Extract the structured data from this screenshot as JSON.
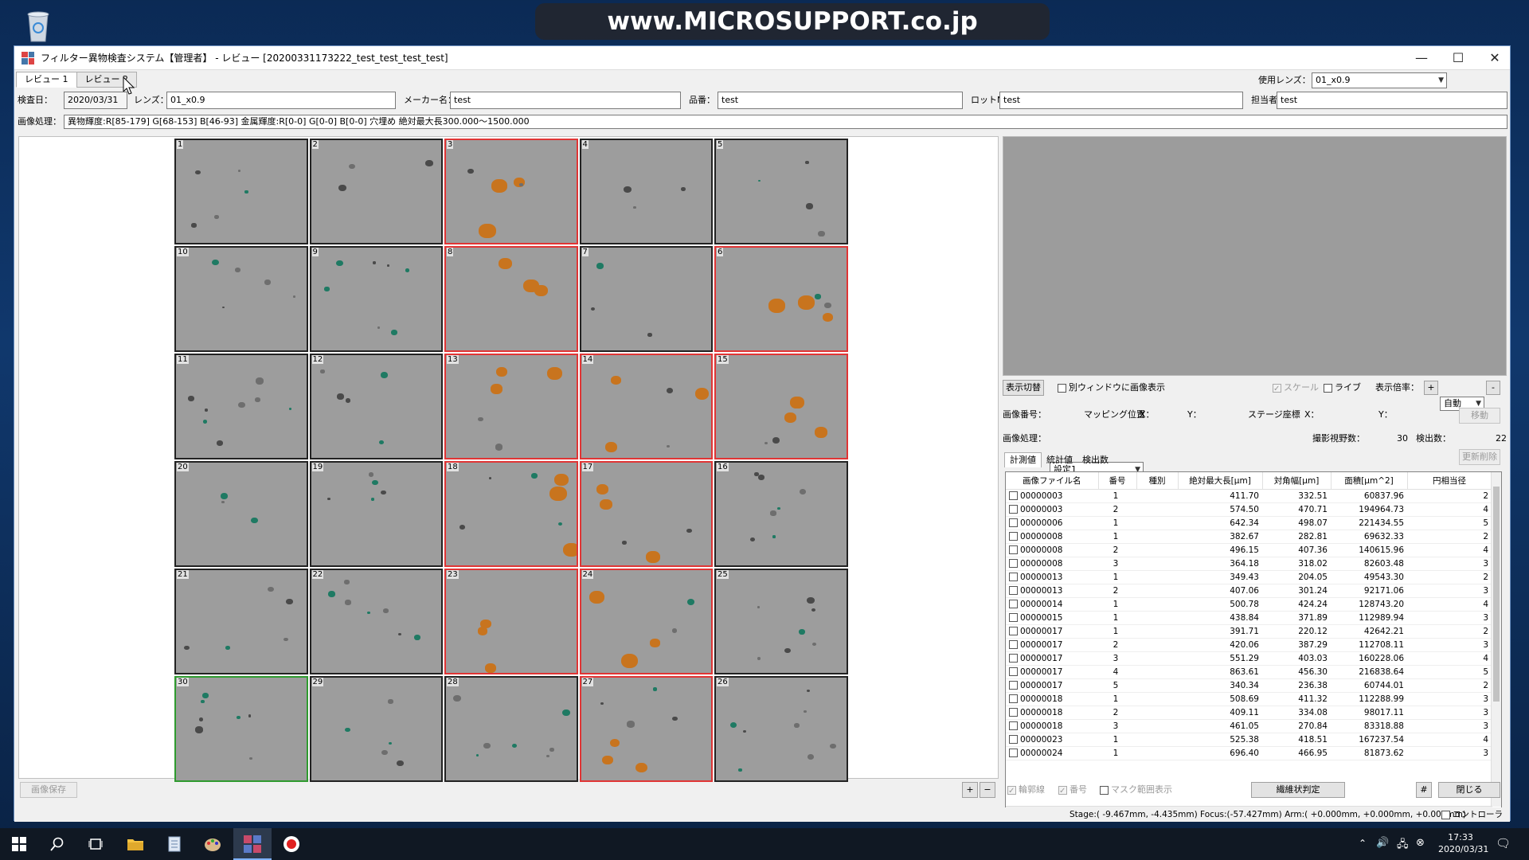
{
  "desktop": {
    "banner": "www.MICROSUPPORT.co.jp",
    "recycle_icon": "recycle-bin-icon"
  },
  "window": {
    "title": "フィルター異物検査システム【管理者】 - レビュー [20200331173222_test_test_test_test]",
    "controls": {
      "minimize": "—",
      "maximize": "☐",
      "close": "✕"
    }
  },
  "tabs": [
    "レビュー 1",
    "レビュー 2"
  ],
  "lens_select": {
    "label": "使用レンズ：",
    "value": "01_x0.9"
  },
  "info": {
    "date_label": "検査日：",
    "date": "2020/03/31",
    "lens_label": "レンズ：",
    "lens": "01_x0.9",
    "maker_label": "メーカー名：",
    "maker": "test",
    "part_label": "品番：",
    "part": "test",
    "lot_label": "ロットNo.：",
    "lot": "test",
    "person_label": "担当者：",
    "person": "test"
  },
  "processing": {
    "label": "画像処理：",
    "text": "異物輝度:R[85-179] G[68-153] B[46-93]  金属輝度:R[0-0] G[0-0] B[0-0]  穴埋め  絶対最大長300.000～1500.000"
  },
  "grid": {
    "rows": [
      [
        {
          "n": "1",
          "s": ""
        },
        {
          "n": "2",
          "s": ""
        },
        {
          "n": "3",
          "s": "red"
        },
        {
          "n": "4",
          "s": ""
        },
        {
          "n": "5",
          "s": ""
        }
      ],
      [
        {
          "n": "10",
          "s": ""
        },
        {
          "n": "9",
          "s": ""
        },
        {
          "n": "8",
          "s": "red"
        },
        {
          "n": "7",
          "s": ""
        },
        {
          "n": "6",
          "s": "red"
        }
      ],
      [
        {
          "n": "11",
          "s": ""
        },
        {
          "n": "12",
          "s": ""
        },
        {
          "n": "13",
          "s": "red"
        },
        {
          "n": "14",
          "s": "red"
        },
        {
          "n": "15",
          "s": "red"
        }
      ],
      [
        {
          "n": "20",
          "s": ""
        },
        {
          "n": "19",
          "s": ""
        },
        {
          "n": "18",
          "s": "red"
        },
        {
          "n": "17",
          "s": "red"
        },
        {
          "n": "16",
          "s": ""
        }
      ],
      [
        {
          "n": "21",
          "s": ""
        },
        {
          "n": "22",
          "s": ""
        },
        {
          "n": "23",
          "s": "red"
        },
        {
          "n": "24",
          "s": "red"
        },
        {
          "n": "25",
          "s": ""
        }
      ],
      [
        {
          "n": "30",
          "s": "green"
        },
        {
          "n": "29",
          "s": ""
        },
        {
          "n": "28",
          "s": ""
        },
        {
          "n": "27",
          "s": "red"
        },
        {
          "n": "26",
          "s": ""
        }
      ]
    ]
  },
  "grid_buttons": {
    "save": "画像保存",
    "plus": "+",
    "minus": "−"
  },
  "right": {
    "toggle_display": "表示切替",
    "separate_window": "別ウィンドウに画像表示",
    "scale": "スケール",
    "live": "ライブ",
    "zoom_label": "表示倍率：",
    "zoom_plus": "+",
    "zoom_value": "自動",
    "zoom_minus": "-",
    "image_no_label": "画像番号：",
    "mapping_label": "マッピング位置",
    "x_label": "X：",
    "y_label": "Y：",
    "stage_label": "ステージ座標",
    "move": "移動",
    "proc_label": "画像処理：",
    "proc_value": "設定1",
    "fields_label": "撮影視野数：",
    "fields_value": "30",
    "detect_label": "検出数：",
    "detect_value": "22",
    "refresh": "更新削除",
    "subtabs": [
      "計測値",
      "統計値",
      "検出数"
    ]
  },
  "table": {
    "headers": [
      "画像ファイル名",
      "番号",
      "種別",
      "絶対最大長[μm]",
      "対角幅[μm]",
      "面積[μm^2]",
      "円相当径"
    ],
    "rows": [
      [
        "00000003",
        "1",
        "",
        "411.70",
        "332.51",
        "60837.96",
        "2"
      ],
      [
        "00000003",
        "2",
        "",
        "574.50",
        "470.71",
        "194964.73",
        "4"
      ],
      [
        "00000006",
        "1",
        "",
        "642.34",
        "498.07",
        "221434.55",
        "5"
      ],
      [
        "00000008",
        "1",
        "",
        "382.67",
        "282.81",
        "69632.33",
        "2"
      ],
      [
        "00000008",
        "2",
        "",
        "496.15",
        "407.36",
        "140615.96",
        "4"
      ],
      [
        "00000008",
        "3",
        "",
        "364.18",
        "318.02",
        "82603.48",
        "3"
      ],
      [
        "00000013",
        "1",
        "",
        "349.43",
        "204.05",
        "49543.30",
        "2"
      ],
      [
        "00000013",
        "2",
        "",
        "407.06",
        "301.24",
        "92171.06",
        "3"
      ],
      [
        "00000014",
        "1",
        "",
        "500.78",
        "424.24",
        "128743.20",
        "4"
      ],
      [
        "00000015",
        "1",
        "",
        "438.84",
        "371.89",
        "112989.94",
        "3"
      ],
      [
        "00000017",
        "1",
        "",
        "391.71",
        "220.12",
        "42642.21",
        "2"
      ],
      [
        "00000017",
        "2",
        "",
        "420.06",
        "387.29",
        "112708.11",
        "3"
      ],
      [
        "00000017",
        "3",
        "",
        "551.29",
        "403.03",
        "160228.06",
        "4"
      ],
      [
        "00000017",
        "4",
        "",
        "863.61",
        "456.30",
        "216838.64",
        "5"
      ],
      [
        "00000017",
        "5",
        "",
        "340.34",
        "236.38",
        "60744.01",
        "2"
      ],
      [
        "00000018",
        "1",
        "",
        "508.69",
        "411.32",
        "112288.99",
        "3"
      ],
      [
        "00000018",
        "2",
        "",
        "409.11",
        "334.08",
        "98017.11",
        "3"
      ],
      [
        "00000018",
        "3",
        "",
        "461.05",
        "270.84",
        "83318.88",
        "3"
      ],
      [
        "00000023",
        "1",
        "",
        "525.38",
        "418.51",
        "167237.54",
        "4"
      ],
      [
        "00000024",
        "1",
        "",
        "696.40",
        "466.95",
        "81873.62",
        "3"
      ]
    ]
  },
  "bottom": {
    "outline": "輪郭線",
    "number": "番号",
    "mask": "マスク範囲表示",
    "fiber": "繊維状判定",
    "hash": "#",
    "close": "閉じる"
  },
  "status": {
    "text": "Stage:( -9.467mm, -4.435mm)  Focus:(-57.427mm)  Arm:( +0.000mm, +0.000mm, +0.000mm)",
    "controller": "コントローラ"
  },
  "taskbar": {
    "time": "17:33",
    "date": "2020/03/31"
  },
  "colors": {
    "accent_red": "#e03535",
    "accent_green": "#2f9b2f",
    "tile_bg": "#9d9d9d",
    "particle_orange": "#c8741e",
    "particle_teal": "#1f7a63"
  }
}
